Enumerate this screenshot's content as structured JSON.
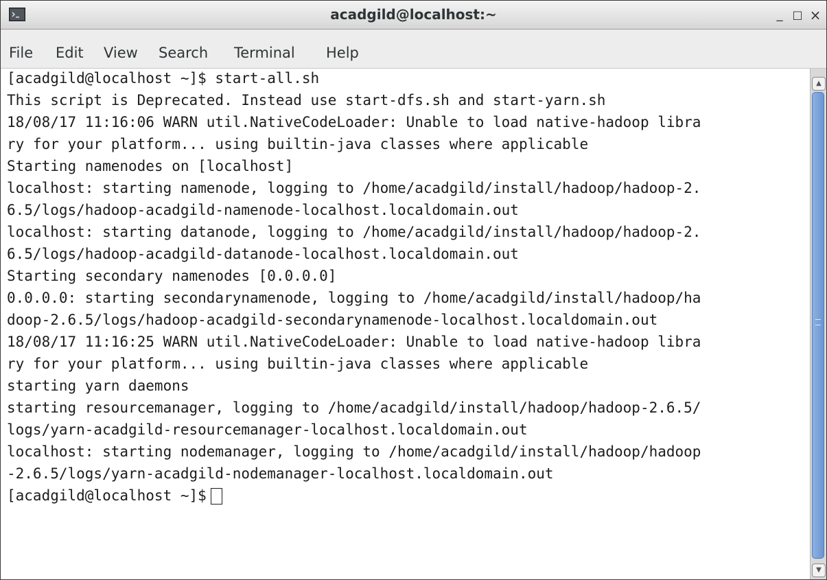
{
  "window": {
    "title": "acadgild@localhost:~",
    "controls": {
      "minimize": "_",
      "maximize": "□",
      "close": "×"
    },
    "icon": "terminal-icon"
  },
  "menu": {
    "file": "File",
    "edit": "Edit",
    "view": "View",
    "search": "Search",
    "terminal": "Terminal",
    "help": "Help"
  },
  "terminal": {
    "lines": [
      "[acadgild@localhost ~]$ start-all.sh",
      "This script is Deprecated. Instead use start-dfs.sh and start-yarn.sh",
      "18/08/17 11:16:06 WARN util.NativeCodeLoader: Unable to load native-hadoop libra",
      "ry for your platform... using builtin-java classes where applicable",
      "Starting namenodes on [localhost]",
      "localhost: starting namenode, logging to /home/acadgild/install/hadoop/hadoop-2.",
      "6.5/logs/hadoop-acadgild-namenode-localhost.localdomain.out",
      "localhost: starting datanode, logging to /home/acadgild/install/hadoop/hadoop-2.",
      "6.5/logs/hadoop-acadgild-datanode-localhost.localdomain.out",
      "Starting secondary namenodes [0.0.0.0]",
      "0.0.0.0: starting secondarynamenode, logging to /home/acadgild/install/hadoop/ha",
      "doop-2.6.5/logs/hadoop-acadgild-secondarynamenode-localhost.localdomain.out",
      "18/08/17 11:16:25 WARN util.NativeCodeLoader: Unable to load native-hadoop libra",
      "ry for your platform... using builtin-java classes where applicable",
      "starting yarn daemons",
      "starting resourcemanager, logging to /home/acadgild/install/hadoop/hadoop-2.6.5/",
      "logs/yarn-acadgild-resourcemanager-localhost.localdomain.out",
      "localhost: starting nodemanager, logging to /home/acadgild/install/hadoop/hadoop",
      "-2.6.5/logs/yarn-acadgild-nodemanager-localhost.localdomain.out"
    ],
    "prompt": "[acadgild@localhost ~]$"
  },
  "colors": {
    "scroll_thumb": "#6b95d1",
    "text": "#1c1c1c",
    "background": "#ffffff"
  }
}
